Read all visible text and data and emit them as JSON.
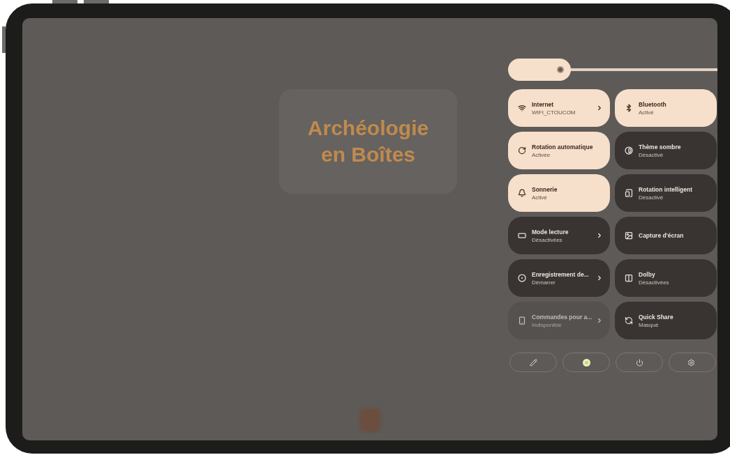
{
  "background_app": {
    "logo_lines": [
      "Archéologie",
      "en Boîtes"
    ]
  },
  "quick_settings": {
    "brightness": {
      "level": 0.3
    },
    "tiles": [
      {
        "title": "Internet",
        "subtitle": "WIFI_CTOUCOM",
        "on": true,
        "disabled": false,
        "chevron": true
      },
      {
        "title": "Bluetooth",
        "subtitle": "Activé",
        "on": true,
        "disabled": false,
        "chevron": false
      },
      {
        "title": "Rotation automatique",
        "subtitle": "Activée",
        "on": true,
        "disabled": false,
        "chevron": false
      },
      {
        "title": "Thème sombre",
        "subtitle": "Désactivé",
        "on": false,
        "disabled": false,
        "chevron": false
      },
      {
        "title": "Sonnerie",
        "subtitle": "Activé",
        "on": true,
        "disabled": false,
        "chevron": false
      },
      {
        "title": "Rotation intelligent",
        "subtitle": "Désactivé",
        "on": false,
        "disabled": false,
        "chevron": false
      },
      {
        "title": "Mode lecture",
        "subtitle": "Désactivées",
        "on": false,
        "disabled": false,
        "chevron": true
      },
      {
        "title": "Capture d'écran",
        "on": false,
        "disabled": false,
        "chevron": false
      },
      {
        "title": "Enregistrement de...",
        "subtitle": "Démarrer",
        "on": false,
        "disabled": false,
        "chevron": true
      },
      {
        "title": "Dolby",
        "subtitle": "Désactivées",
        "on": false,
        "disabled": false,
        "chevron": false
      },
      {
        "title": "Commandes pour a...",
        "subtitle": "Indisponible",
        "on": false,
        "disabled": true,
        "chevron": true
      },
      {
        "title": "Quick Share",
        "subtitle": "Masqué",
        "on": false,
        "disabled": false,
        "chevron": false
      }
    ]
  }
}
